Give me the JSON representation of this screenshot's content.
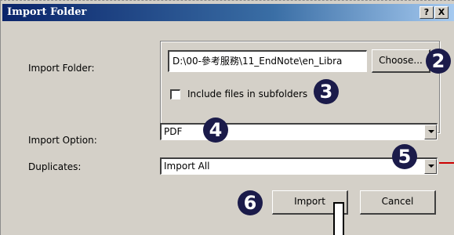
{
  "window": {
    "title": "Import Folder",
    "help_label": "?",
    "close_label": "X"
  },
  "import_folder": {
    "label": "Import Folder:",
    "path_value": "D:\\00-參考服務\\11_EndNote\\en_Libra",
    "choose_button": "Choose...",
    "include_subfolders_label": "Include files in subfolders",
    "include_subfolders_checked": false
  },
  "import_option": {
    "label": "Import Option:",
    "selected": "PDF"
  },
  "duplicates": {
    "label": "Duplicates:",
    "selected": "Import All"
  },
  "buttons": {
    "import": "Import",
    "cancel": "Cancel"
  },
  "annotations": {
    "step2": "2",
    "step3": "3",
    "step4": "4",
    "step5": "5",
    "step6": "6",
    "badge_color": "#1b1b4a",
    "arrow_color": "#cc0000"
  }
}
